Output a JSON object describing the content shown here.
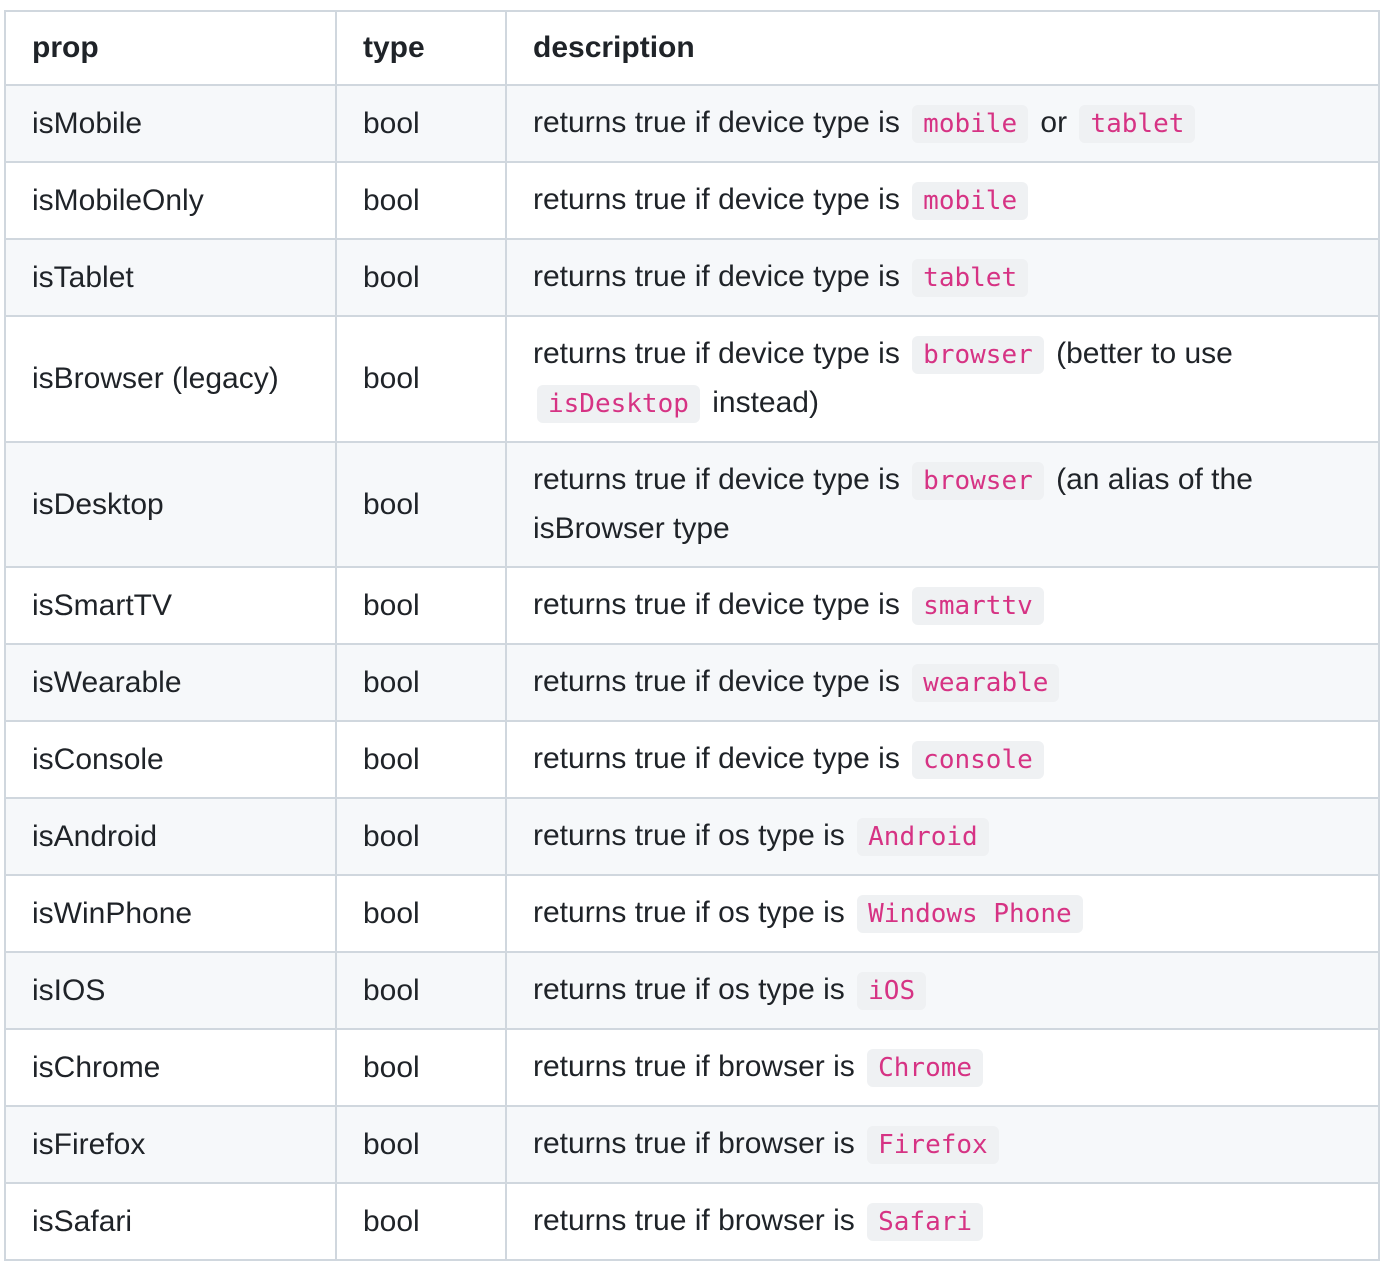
{
  "table": {
    "headers": {
      "prop": "prop",
      "type": "type",
      "description": "description"
    },
    "rows": [
      {
        "prop": "isMobile",
        "type": "bool",
        "desc": [
          {
            "text": "returns true if device type is "
          },
          {
            "code": "mobile"
          },
          {
            "text": " or "
          },
          {
            "code": "tablet"
          }
        ]
      },
      {
        "prop": "isMobileOnly",
        "type": "bool",
        "desc": [
          {
            "text": "returns true if device type is "
          },
          {
            "code": "mobile"
          }
        ]
      },
      {
        "prop": "isTablet",
        "type": "bool",
        "desc": [
          {
            "text": "returns true if device type is "
          },
          {
            "code": "tablet"
          }
        ]
      },
      {
        "prop": "isBrowser (legacy)",
        "type": "bool",
        "desc": [
          {
            "text": "returns true if device type is "
          },
          {
            "code": "browser"
          },
          {
            "text": " (better to use "
          },
          {
            "code": "isDesktop"
          },
          {
            "text": " instead)"
          }
        ]
      },
      {
        "prop": "isDesktop",
        "type": "bool",
        "desc": [
          {
            "text": "returns true if device type is "
          },
          {
            "code": "browser"
          },
          {
            "text": " (an alias of the isBrowser type"
          }
        ]
      },
      {
        "prop": "isSmartTV",
        "type": "bool",
        "desc": [
          {
            "text": "returns true if device type is "
          },
          {
            "code": "smarttv"
          }
        ]
      },
      {
        "prop": "isWearable",
        "type": "bool",
        "desc": [
          {
            "text": "returns true if device type is "
          },
          {
            "code": "wearable"
          }
        ]
      },
      {
        "prop": "isConsole",
        "type": "bool",
        "desc": [
          {
            "text": "returns true if device type is "
          },
          {
            "code": "console"
          }
        ]
      },
      {
        "prop": "isAndroid",
        "type": "bool",
        "desc": [
          {
            "text": "returns true if os type is "
          },
          {
            "code": "Android"
          }
        ]
      },
      {
        "prop": "isWinPhone",
        "type": "bool",
        "desc": [
          {
            "text": "returns true if os type is "
          },
          {
            "code": "Windows Phone"
          }
        ]
      },
      {
        "prop": "isIOS",
        "type": "bool",
        "desc": [
          {
            "text": "returns true if os type is "
          },
          {
            "code": "iOS"
          }
        ]
      },
      {
        "prop": "isChrome",
        "type": "bool",
        "desc": [
          {
            "text": "returns true if browser is "
          },
          {
            "code": "Chrome"
          }
        ]
      },
      {
        "prop": "isFirefox",
        "type": "bool",
        "desc": [
          {
            "text": "returns true if browser is "
          },
          {
            "code": "Firefox"
          }
        ]
      },
      {
        "prop": "isSafari",
        "type": "bool",
        "desc": [
          {
            "text": "returns true if browser is "
          },
          {
            "code": "Safari"
          }
        ]
      }
    ]
  },
  "colors": {
    "code_text": "#d63384",
    "code_bg": "#eff1f3",
    "border": "#d0d7de",
    "stripe": "#f6f8fa",
    "text": "#1f2328"
  }
}
